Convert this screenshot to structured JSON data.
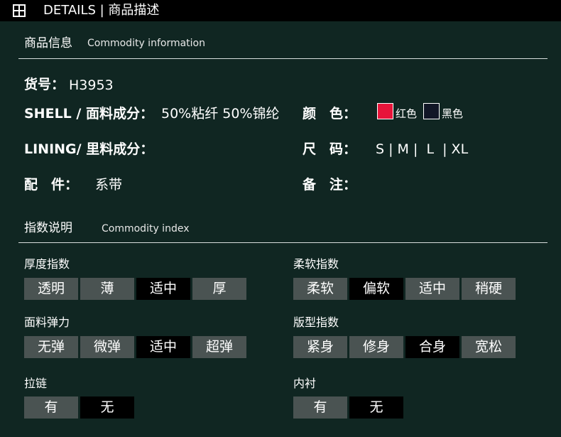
{
  "header": {
    "title": "DETAILS | 商品描述"
  },
  "info_section": {
    "title_zh": "商品信息",
    "title_en": "Commodity information"
  },
  "fields": {
    "item_no_label": "货号：",
    "item_no_value": "H3953",
    "shell_label": "SHELL / 面料成分：",
    "shell_value": "50%粘纤 50%锦纶",
    "color_label": "颜　色：",
    "colors": [
      {
        "swatch": "#e8143a",
        "name": "红色"
      },
      {
        "swatch": "#111626",
        "name": "黑色"
      }
    ],
    "lining_label": "LINING/ 里料成分：",
    "lining_value": "",
    "size_label": "尺　码：",
    "size_value": "S | M |  L  | XL",
    "accessory_label": "配　件：",
    "accessory_value": "系带",
    "note_label": "备　注：",
    "note_value": ""
  },
  "index_section": {
    "title_zh": "指数说明",
    "title_en": "Commodity index"
  },
  "indexes": {
    "thickness": {
      "title": "厚度指数",
      "options": [
        "透明",
        "薄",
        "适中",
        "厚"
      ],
      "selected": 2
    },
    "softness": {
      "title": "柔软指数",
      "options": [
        "柔软",
        "偏软",
        "适中",
        "稍硬"
      ],
      "selected": 1
    },
    "elasticity": {
      "title": "面料弹力",
      "options": [
        "无弹",
        "微弹",
        "适中",
        "超弹"
      ],
      "selected": 2
    },
    "fit": {
      "title": "版型指数",
      "options": [
        "紧身",
        "修身",
        "合身",
        "宽松"
      ],
      "selected": 2
    },
    "zipper": {
      "title": "拉链",
      "options": [
        "有",
        "无"
      ],
      "selected": 1
    },
    "lining": {
      "title": "内衬",
      "options": [
        "有",
        "无"
      ],
      "selected": 1
    }
  },
  "colors": {
    "background": "#102622",
    "header_bg": "#000000",
    "button_bg": "#4a5352",
    "button_selected_bg": "#000000"
  }
}
